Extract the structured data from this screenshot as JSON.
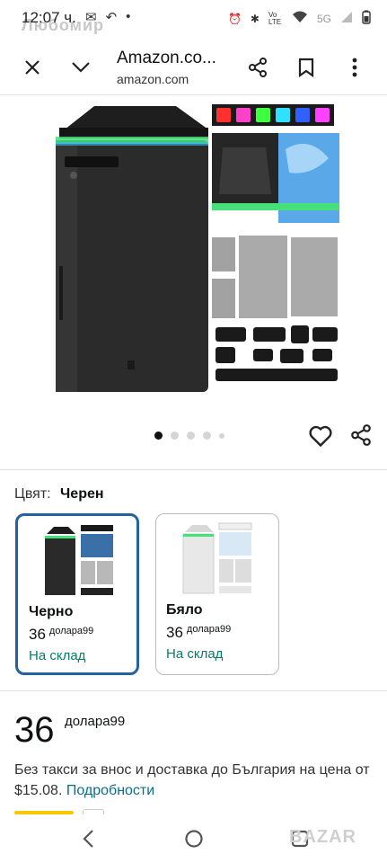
{
  "status_bar": {
    "time": "12:07 ч.",
    "ghost_text": "Любомир",
    "network": "5G",
    "volte": "Vo LTE"
  },
  "browser": {
    "title": "Amazon.co...",
    "domain": "amazon.com",
    "icons": [
      "close-icon",
      "chevron-down-icon",
      "share-icon",
      "bookmark-icon",
      "more-vert-icon"
    ]
  },
  "gallery": {
    "image_count": 5,
    "active_index": 0,
    "led_colors": [
      "#ff3030",
      "#ff40c8",
      "#40ff40",
      "#30e0ff",
      "#3060ff",
      "#ff40ff"
    ]
  },
  "product": {
    "color_label": "Цвят:",
    "color_value": "Черен",
    "variants": [
      {
        "name": "Черно",
        "price": "36",
        "currency": "долара99",
        "stock": "На склад",
        "selected": true
      },
      {
        "name": "Бяло",
        "price": "36",
        "currency": "долара99",
        "stock": "На склад",
        "selected": false
      }
    ],
    "price_whole": "36",
    "price_currency": "долара99",
    "tax_text": "Без такси за внос и доставка до България на цена от $15.08.",
    "details_link": "Подробности"
  },
  "watermark": "BAZAR",
  "colors": {
    "selected_border": "#2162a1",
    "in_stock": "#067d62",
    "link": "#0a6d8a"
  }
}
